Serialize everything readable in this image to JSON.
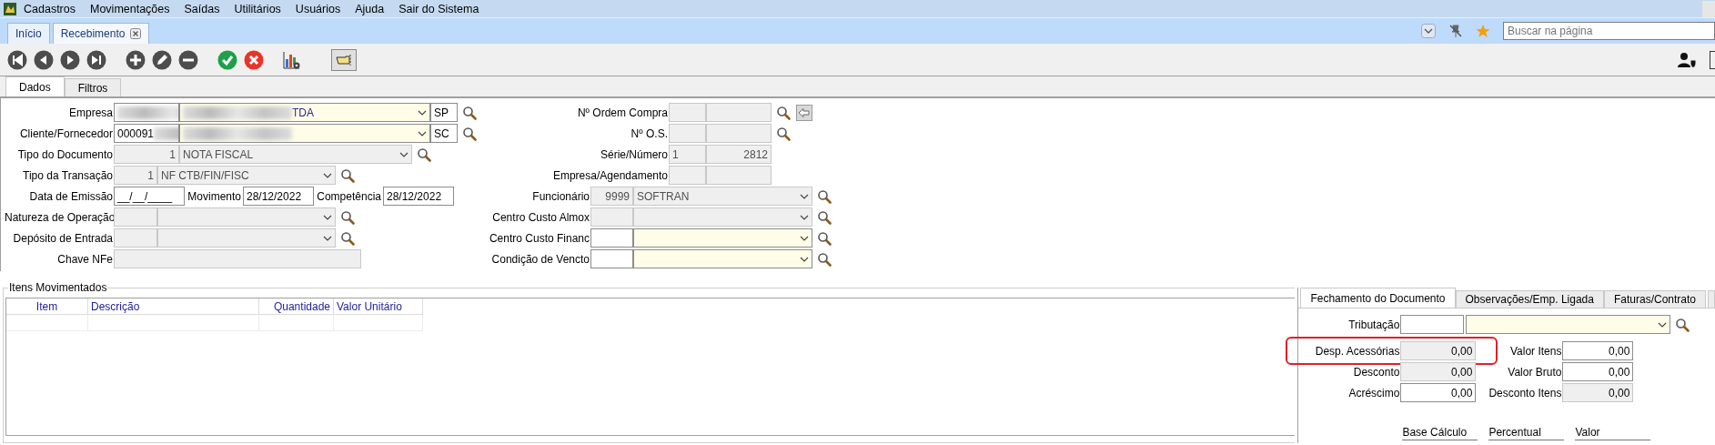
{
  "menu": {
    "items": [
      "Cadastros",
      "Movimentações",
      "Saídas",
      "Utilitários",
      "Usuários",
      "Ajuda",
      "Sair do Sistema"
    ]
  },
  "tabs": [
    {
      "label": "Início",
      "selected": false,
      "closable": false
    },
    {
      "label": "Recebimento",
      "selected": true,
      "closable": true
    }
  ],
  "search": {
    "placeholder": "Buscar na página"
  },
  "subtabs": [
    {
      "label": "Dados",
      "selected": true
    },
    {
      "label": "Filtros",
      "selected": false
    }
  ],
  "form": {
    "left": [
      {
        "label": "Empresa",
        "controls": [
          {
            "kind": "input",
            "redacted": true
          },
          {
            "kind": "combo",
            "value": "TDA",
            "redacted": true,
            "highlighted": true
          },
          {
            "kind": "input",
            "value": "SP"
          },
          {
            "kind": "lookup"
          }
        ]
      },
      {
        "label": "Cliente/Fornecedor",
        "controls": [
          {
            "kind": "input",
            "value": "000091",
            "redacted": true
          },
          {
            "kind": "combo",
            "redacted": true,
            "highlighted": true
          },
          {
            "kind": "input",
            "value": "SC"
          },
          {
            "kind": "lookup"
          }
        ]
      },
      {
        "label": "Tipo do Documento",
        "controls": [
          {
            "kind": "input",
            "value": "1",
            "disabled": true
          },
          {
            "kind": "combo",
            "value": "NOTA FISCAL",
            "disabled": true
          },
          {
            "kind": "lookup"
          }
        ]
      },
      {
        "label": "Tipo da Transação",
        "controls": [
          {
            "kind": "input",
            "value": "1",
            "disabled": true
          },
          {
            "kind": "combo",
            "value": "NF CTB/FIN/FISC",
            "disabled": true
          },
          {
            "kind": "lookup"
          }
        ]
      },
      {
        "label": "Data de Emissão",
        "controls": [
          {
            "kind": "input",
            "value": "__/__/____"
          },
          {
            "kind": "label",
            "value": "Movimento"
          },
          {
            "kind": "input",
            "value": "28/12/2022"
          },
          {
            "kind": "label",
            "value": "Competência"
          },
          {
            "kind": "input",
            "value": "28/12/2022"
          }
        ]
      },
      {
        "label": "Natureza de Operação",
        "controls": [
          {
            "kind": "input",
            "disabled": true
          },
          {
            "kind": "combo",
            "disabled": true
          },
          {
            "kind": "lookup"
          }
        ]
      },
      {
        "label": "Depósito de Entrada",
        "controls": [
          {
            "kind": "input",
            "disabled": true
          },
          {
            "kind": "combo",
            "disabled": true
          },
          {
            "kind": "lookup"
          }
        ]
      },
      {
        "label": "Chave NFe",
        "controls": [
          {
            "kind": "input",
            "disabled": true
          }
        ]
      }
    ],
    "right": [
      {
        "label": "Nº Ordem Compra",
        "controls": [
          {
            "kind": "input",
            "disabled": true
          },
          {
            "kind": "input",
            "disabled": true
          },
          {
            "kind": "lookup"
          },
          {
            "kind": "back"
          }
        ]
      },
      {
        "label": "Nº O.S.",
        "controls": [
          {
            "kind": "input",
            "disabled": true
          },
          {
            "kind": "input",
            "disabled": true
          },
          {
            "kind": "lookup"
          }
        ]
      },
      {
        "label": "Série/Número",
        "controls": [
          {
            "kind": "input",
            "value": "1",
            "disabled": true
          },
          {
            "kind": "input",
            "value": "2812",
            "disabled": true
          }
        ]
      },
      {
        "label": "Empresa/Agendamento",
        "controls": [
          {
            "kind": "input",
            "disabled": true
          },
          {
            "kind": "input",
            "disabled": true
          }
        ]
      },
      {
        "label": "Funcionário",
        "controls": [
          {
            "kind": "input",
            "value": "9999",
            "disabled": true
          },
          {
            "kind": "combo",
            "value": "SOFTRAN",
            "disabled": true
          },
          {
            "kind": "lookup"
          }
        ]
      },
      {
        "label": "Centro Custo Almox",
        "controls": [
          {
            "kind": "input",
            "disabled": true
          },
          {
            "kind": "combo",
            "disabled": true
          },
          {
            "kind": "lookup"
          }
        ]
      },
      {
        "label": "Centro Custo Financ",
        "controls": [
          {
            "kind": "input"
          },
          {
            "kind": "combo",
            "highlighted": true
          },
          {
            "kind": "lookup"
          }
        ]
      },
      {
        "label": "Condição de Vencto",
        "controls": [
          {
            "kind": "input"
          },
          {
            "kind": "combo",
            "highlighted": true
          },
          {
            "kind": "lookup"
          }
        ]
      }
    ]
  },
  "items": {
    "title": "Itens Movimentados",
    "columns": [
      "Item",
      "Descrição",
      "Quantidade",
      "Valor Unitário"
    ]
  },
  "summary": {
    "tabs": [
      {
        "label": "Fechamento do Documento",
        "selected": true
      },
      {
        "label": "Observações/Emp. Ligada",
        "selected": false
      },
      {
        "label": "Faturas/Contrato",
        "selected": false
      }
    ],
    "tributacao": {
      "label": "Tributação"
    },
    "rows": [
      {
        "label": "Desp. Acessórias",
        "value": "0,00",
        "disabled": true,
        "annotated": true,
        "label2": "Valor Itens",
        "value2": "0,00",
        "disabled2": false
      },
      {
        "label": "Desconto",
        "value": "0,00",
        "disabled": true,
        "annotated": false,
        "label2": "Valor Bruto",
        "value2": "0,00",
        "disabled2": false
      },
      {
        "label": "Acréscimo",
        "value": "0,00",
        "disabled": false,
        "annotated": false,
        "label2": "Desconto Itens",
        "value2": "0,00",
        "disabled2": true
      }
    ],
    "headings": [
      "Base Cálculo",
      "Percentual",
      "Valor"
    ]
  }
}
